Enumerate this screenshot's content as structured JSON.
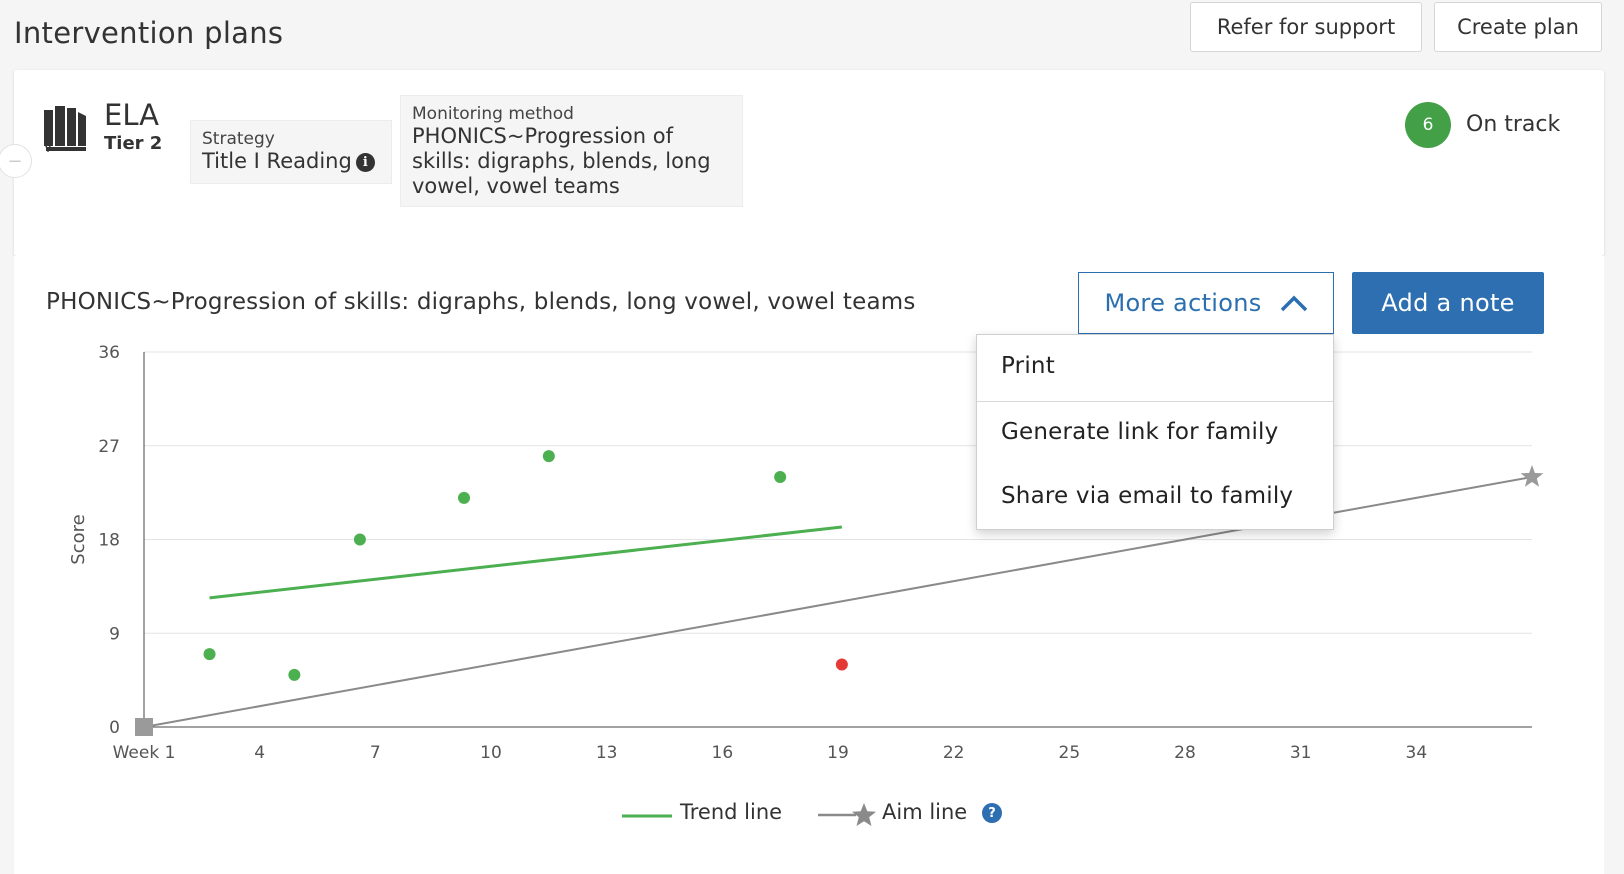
{
  "page": {
    "title": "Intervention plans"
  },
  "header_buttons": {
    "refer": "Refer for support",
    "create": "Create plan"
  },
  "plan": {
    "subject": "ELA",
    "tier": "Tier 2",
    "strategy_label": "Strategy",
    "strategy_value": "Title I Reading",
    "strategy_info_glyph": "i",
    "monitoring_label": "Monitoring method",
    "monitoring_value": "PHONICS~Progression of skills: digraphs, blends, long vowel, vowel teams",
    "status_count": "6",
    "status_text": "On track",
    "status_color": "#43a047",
    "collapse_glyph": "−"
  },
  "chart_header": {
    "title": "PHONICS~Progression of skills: digraphs, blends, long vowel, vowel teams",
    "more_actions": "More actions",
    "add_note": "Add a note"
  },
  "menu": {
    "items": [
      "Print",
      "Generate link for family",
      "Share via email to family"
    ]
  },
  "legend": {
    "trend": "Trend line",
    "aim": "Aim line",
    "help_glyph": "?"
  },
  "colors": {
    "accent": "#2d6fb0",
    "on_track": "#4caf50",
    "off_track": "#e53935",
    "aim": "#8a8a8a"
  },
  "icons": {
    "book": "book-icon",
    "info": "info-icon",
    "collapse": "minus-icon",
    "chevron": "chevron-up-icon",
    "help": "question-icon",
    "star": "star-icon",
    "square": "square-icon"
  },
  "chart_data": {
    "type": "scatter",
    "ylabel": "Score",
    "xlabel": "",
    "ylim": [
      0,
      36
    ],
    "xlim": [
      1,
      37
    ],
    "yticks": [
      0,
      9,
      18,
      27,
      36
    ],
    "xticks": [
      1,
      4,
      7,
      10,
      13,
      16,
      19,
      22,
      25,
      28,
      31,
      34
    ],
    "xtick_labels": [
      "Week 1",
      "4",
      "7",
      "10",
      "13",
      "16",
      "19",
      "22",
      "25",
      "28",
      "31",
      "34"
    ],
    "grid": true,
    "legend_position": "bottom",
    "points": [
      {
        "x": 2.7,
        "y": 7,
        "status": "on"
      },
      {
        "x": 4.9,
        "y": 5,
        "status": "on"
      },
      {
        "x": 6.6,
        "y": 18,
        "status": "on"
      },
      {
        "x": 9.3,
        "y": 22,
        "status": "on"
      },
      {
        "x": 11.5,
        "y": 26,
        "status": "on"
      },
      {
        "x": 17.5,
        "y": 24,
        "status": "on"
      },
      {
        "x": 19.1,
        "y": 6,
        "status": "off"
      }
    ],
    "series": [
      {
        "name": "Trend line",
        "x": [
          2.7,
          19.1
        ],
        "y": [
          12.4,
          19.2
        ]
      },
      {
        "name": "Aim line",
        "x": [
          1,
          37
        ],
        "y": [
          0,
          24
        ]
      }
    ]
  }
}
